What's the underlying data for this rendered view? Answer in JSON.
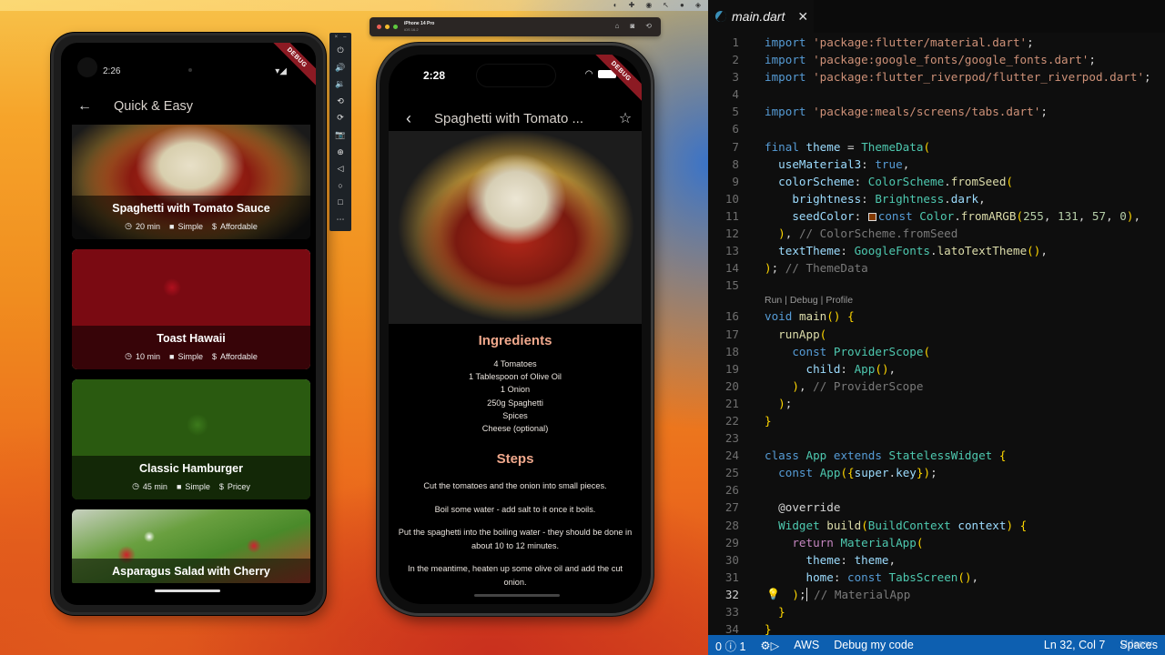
{
  "desktop": {
    "menubar_icons": [
      "headphones-icon",
      "extension-icon",
      "rewind-icon",
      "cursor-icon",
      "record-icon",
      "shield-icon"
    ]
  },
  "android": {
    "time": "2:26",
    "debug_banner": "DEBUG",
    "screen_title": "Quick & Easy",
    "meals": [
      {
        "title": "Spaghetti with Tomato Sauce",
        "duration": "20 min",
        "complexity": "Simple",
        "affordability": "Affordable"
      },
      {
        "title": "Toast Hawaii",
        "duration": "10 min",
        "complexity": "Simple",
        "affordability": "Affordable"
      },
      {
        "title": "Classic Hamburger",
        "duration": "45 min",
        "complexity": "Simple",
        "affordability": "Pricey"
      },
      {
        "title": "Asparagus Salad with Cherry"
      }
    ]
  },
  "emulator_toolbar": {
    "window_controls": [
      "×",
      "–"
    ],
    "buttons": [
      {
        "name": "power",
        "glyph": "⏻"
      },
      {
        "name": "volume-up",
        "glyph": "🔊"
      },
      {
        "name": "volume-down",
        "glyph": "🔉"
      },
      {
        "name": "rotate-left",
        "glyph": "⟲"
      },
      {
        "name": "rotate-right",
        "glyph": "⟳"
      },
      {
        "name": "screenshot",
        "glyph": "📷"
      },
      {
        "name": "zoom",
        "glyph": "⊕"
      },
      {
        "name": "back",
        "glyph": "◁"
      },
      {
        "name": "home",
        "glyph": "○"
      },
      {
        "name": "overview",
        "glyph": "□"
      },
      {
        "name": "more",
        "glyph": "⋯"
      }
    ]
  },
  "ios_simulator": {
    "device_name": "iPhone 14 Pro",
    "os_version": "iOS 16.2",
    "time": "2:28",
    "debug_banner": "DEBUG",
    "screen_title": "Spaghetti with Tomato ...",
    "ingredients_title": "Ingredients",
    "ingredients": [
      "4 Tomatoes",
      "1 Tablespoon of Olive Oil",
      "1 Onion",
      "250g Spaghetti",
      "Spices",
      "Cheese (optional)"
    ],
    "steps_title": "Steps",
    "steps": [
      "Cut the tomatoes and the onion into small pieces.",
      "Boil some water - add salt to it once it boils.",
      "Put the spaghetti into the boiling water - they should be done in about 10 to 12 minutes.",
      "In the meantime, heaten up some olive oil and add the cut onion."
    ]
  },
  "editor": {
    "tab_name": "main.dart",
    "codelens": "Run | Debug | Profile",
    "current_line": 32,
    "seed_color_hex": "#833900",
    "lines": [
      "import 'package:flutter/material.dart';",
      "import 'package:google_fonts/google_fonts.dart';",
      "import 'package:flutter_riverpod/flutter_riverpod.dart';",
      "",
      "import 'package:meals/screens/tabs.dart';",
      "",
      "final theme = ThemeData(",
      "  useMaterial3: true,",
      "  colorScheme: ColorScheme.fromSeed(",
      "    brightness: Brightness.dark,",
      "    seedColor: const Color.fromARGB(255, 131, 57, 0),",
      "  ), // ColorScheme.fromSeed",
      "  textTheme: GoogleFonts.latoTextTheme(),",
      "); // ThemeData",
      "",
      "void main() {",
      "  runApp(",
      "    const ProviderScope(",
      "      child: App(),",
      "    ), // ProviderScope",
      "  );",
      "}",
      "",
      "class App extends StatelessWidget {",
      "  const App({super.key});",
      "",
      "  @override",
      "  Widget build(BuildContext context) {",
      "    return MaterialApp(",
      "      theme: theme,",
      "      home: const TabsScreen(),",
      "    ); // MaterialApp",
      "  }",
      "}"
    ]
  },
  "statusbar": {
    "problems": "0",
    "info_count": "1",
    "aws": "AWS",
    "debug": "Debug my code",
    "position": "Ln 32, Col 7",
    "spaces": "Spaces",
    "watermark": "Udemy"
  }
}
